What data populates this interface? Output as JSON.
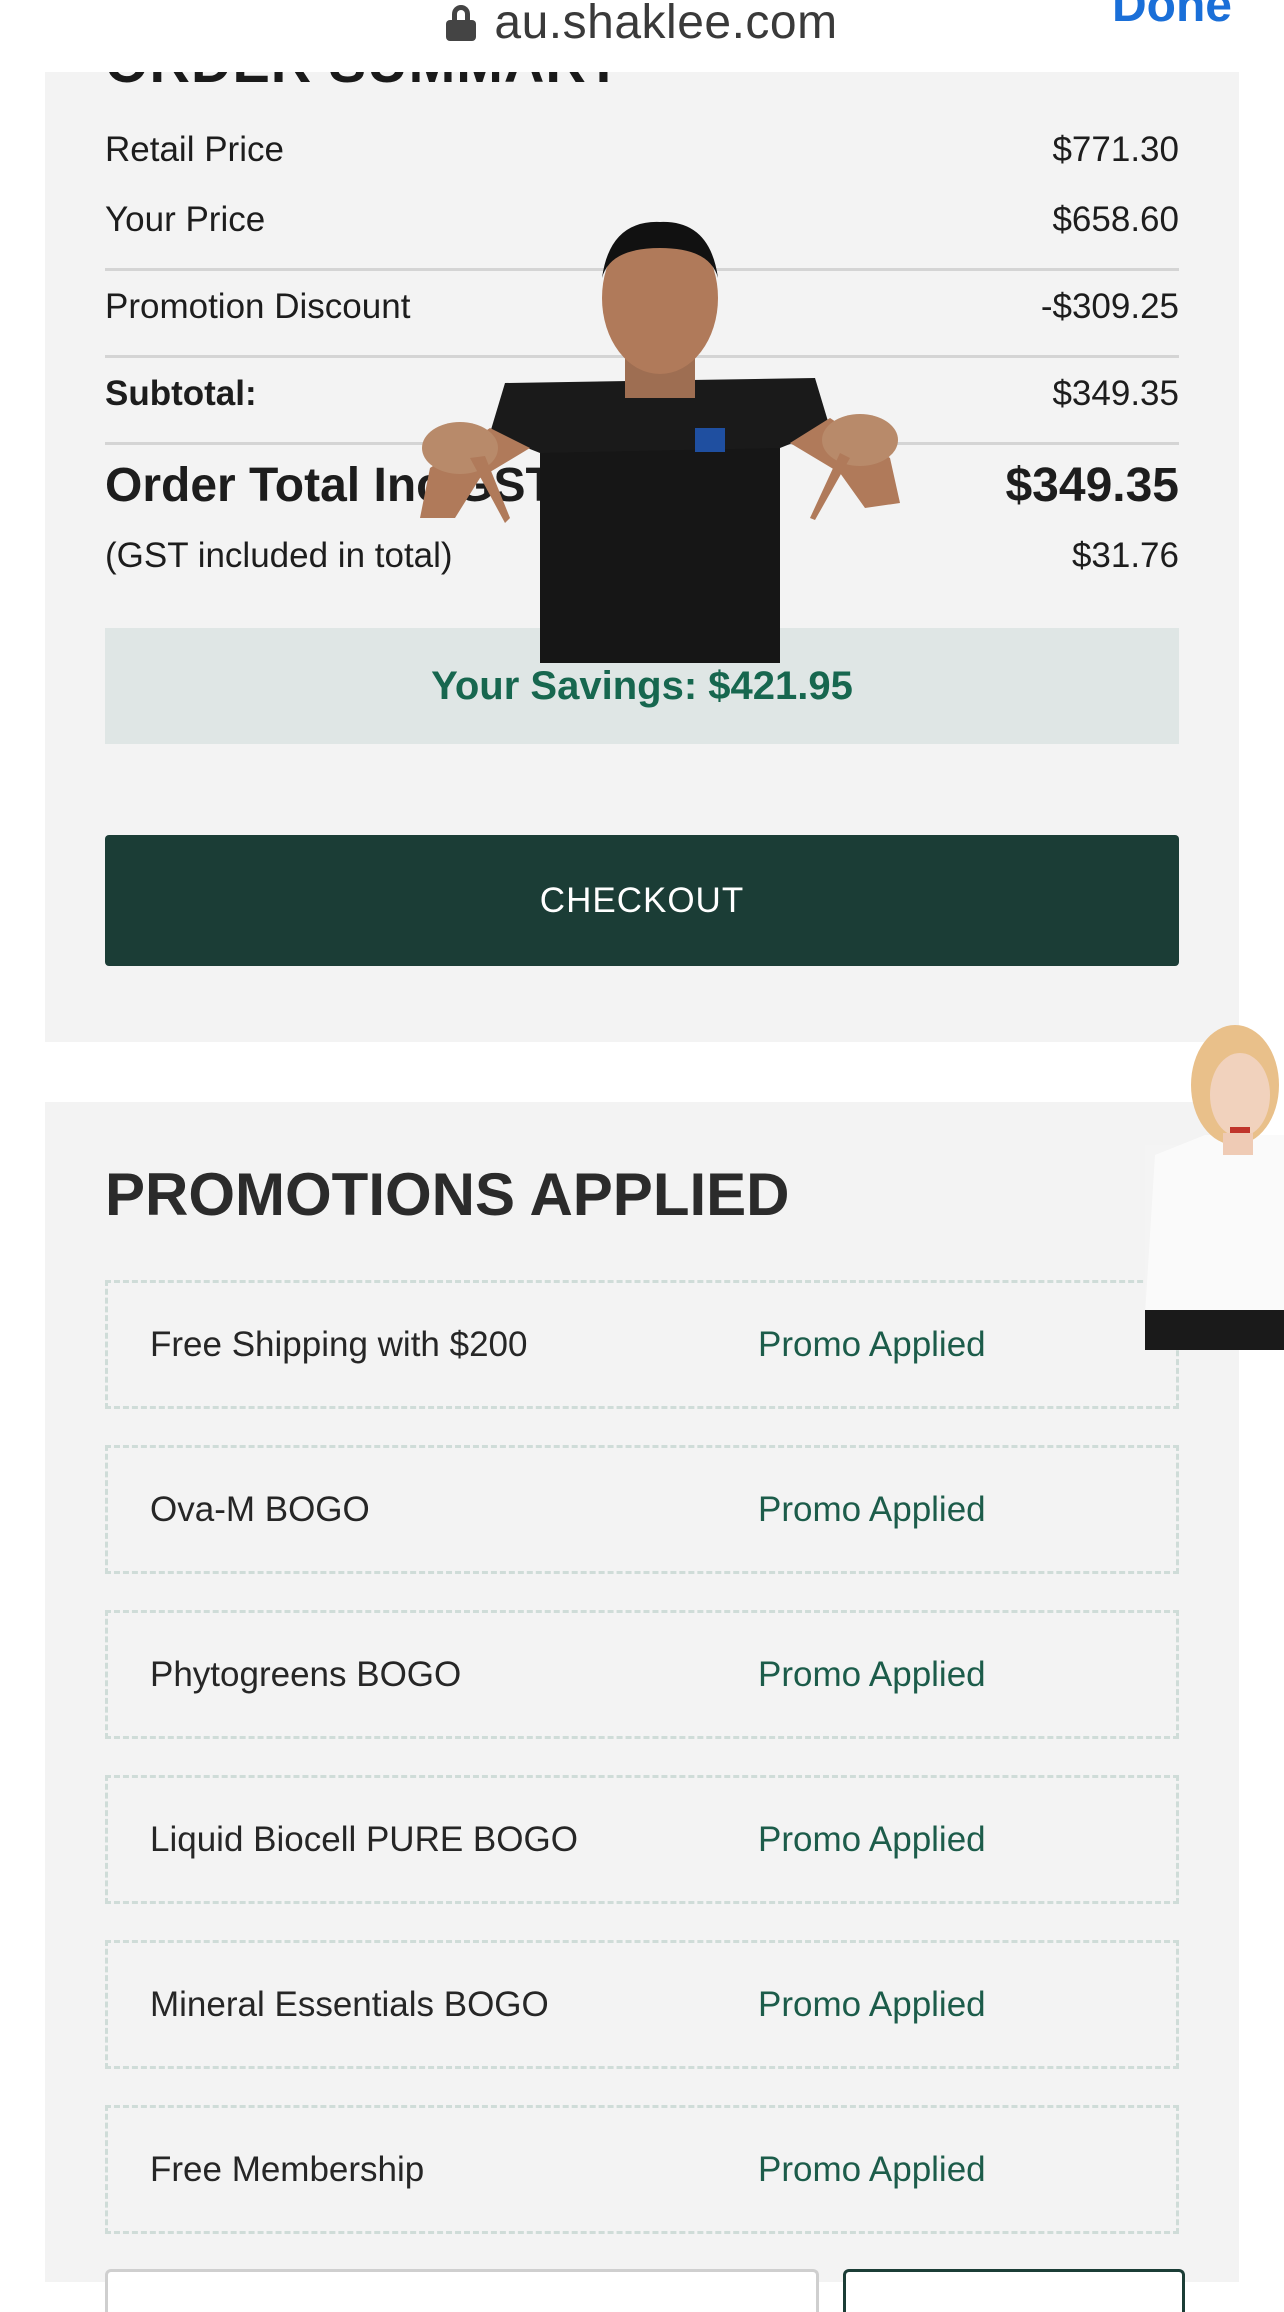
{
  "browser": {
    "url": "au.shaklee.com",
    "done_label": "Done"
  },
  "order_summary": {
    "heading": "ORDER SUMMARY",
    "retail_price_label": "Retail Price",
    "retail_price_value": "$771.30",
    "your_price_label": "Your Price",
    "your_price_value": "$658.60",
    "promotion_discount_label": "Promotion Discount",
    "promotion_discount_value": "-$309.25",
    "subtotal_label": "Subtotal:",
    "subtotal_value": "$349.35",
    "order_total_label": "Order Total Inc GST",
    "order_total_value": "$349.35",
    "gst_label": "(GST included in total)",
    "gst_value": "$31.76",
    "savings_text": "Your Savings: $421.95",
    "checkout_label": "CHECKOUT"
  },
  "promotions": {
    "title": "PROMOTIONS APPLIED",
    "items": [
      {
        "name": "Free Shipping with $200",
        "status": "Promo Applied"
      },
      {
        "name": "Ova-M BOGO",
        "status": "Promo Applied"
      },
      {
        "name": "Phytogreens BOGO",
        "status": "Promo Applied"
      },
      {
        "name": "Liquid Biocell PURE BOGO",
        "status": "Promo Applied"
      },
      {
        "name": "Mineral Essentials BOGO",
        "status": "Promo Applied"
      },
      {
        "name": "Free Membership",
        "status": "Promo Applied"
      }
    ]
  },
  "colors": {
    "brand_dark_green": "#1b3d36",
    "savings_green": "#17674f",
    "savings_bg": "#dfe6e5",
    "link_blue": "#1a6fd8"
  }
}
